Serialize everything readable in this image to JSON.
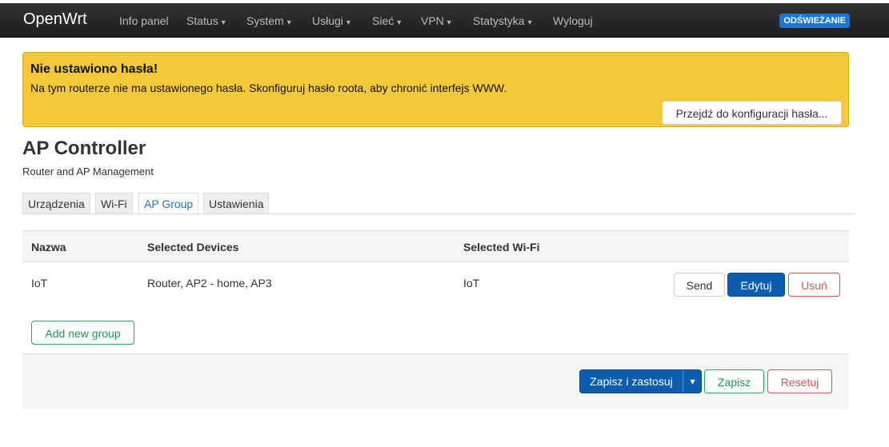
{
  "navbar": {
    "brand": "OpenWrt",
    "items": [
      {
        "label": "Info panel",
        "dropdown": false
      },
      {
        "label": "Status",
        "dropdown": true
      },
      {
        "label": "System",
        "dropdown": true
      },
      {
        "label": "Usługi",
        "dropdown": true
      },
      {
        "label": "Sieć",
        "dropdown": true
      },
      {
        "label": "VPN",
        "dropdown": true
      },
      {
        "label": "Statystyka",
        "dropdown": true
      },
      {
        "label": "Wyloguj",
        "dropdown": false
      }
    ],
    "caret": "▾",
    "refresh_label": "ODŚWIEŻANIE"
  },
  "alert": {
    "title": "Nie ustawiono hasła!",
    "text": "Na tym routerze nie ma ustawionego hasła. Skonfiguruj hasło roota, aby chronić interfejs WWW.",
    "button": "Przejdź do konfiguracji hasła..."
  },
  "page": {
    "title": "AP Controller",
    "subtitle": "Router and AP Management"
  },
  "tabs": [
    {
      "label": "Urządzenia",
      "active": false
    },
    {
      "label": "Wi-Fi",
      "active": false
    },
    {
      "label": "AP Group",
      "active": true
    },
    {
      "label": "Ustawienia",
      "active": false
    }
  ],
  "table": {
    "headers": [
      "Nazwa",
      "Selected Devices",
      "Selected Wi-Fi"
    ],
    "rows": [
      {
        "name": "IoT",
        "devices": "Router, AP2 - home, AP3",
        "wifi": "IoT"
      }
    ],
    "actions": {
      "send": "Send",
      "edit": "Edytuj",
      "delete": "Usuń"
    }
  },
  "add_group": "Add new group",
  "footer": {
    "save_apply": "Zapisz i zastosuj",
    "save_apply_dropdown": "▾",
    "save": "Zapisz",
    "reset": "Resetuj"
  },
  "colors": {
    "navbar": "#222222",
    "accent_blue": "#0e5cae",
    "warning": "#f3c93a",
    "danger": "#d9534f",
    "success": "#26a95a"
  }
}
